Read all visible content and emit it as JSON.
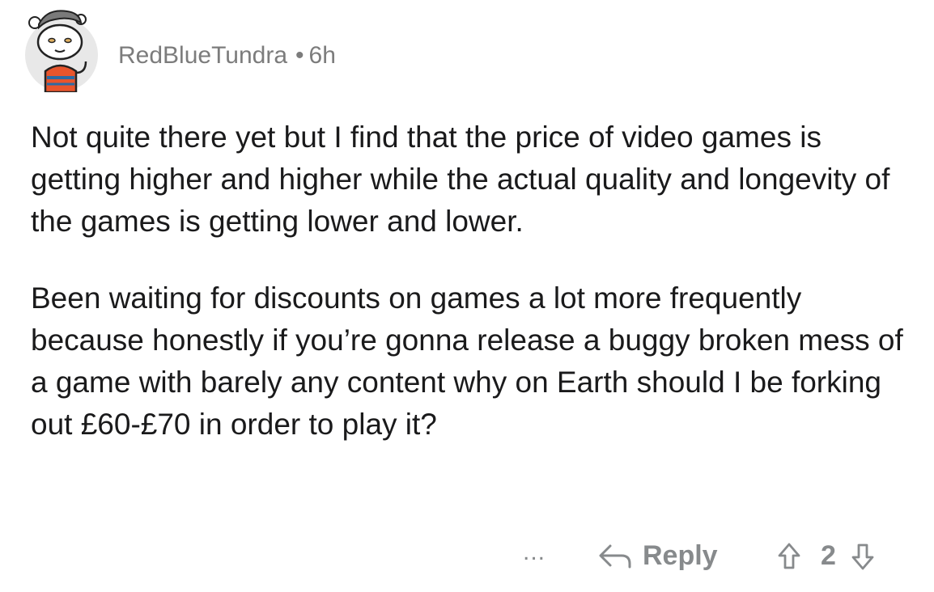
{
  "comment": {
    "username": "RedBlueTundra",
    "separator": "•",
    "age": "6h",
    "paragraphs": [
      "Not quite there yet but I find that the price of video games is getting higher and higher while the actual quality and longevity of the games is getting lower and lower.",
      "Been waiting for discounts on games a lot more frequently because honestly if you’re gonna release a buggy broken mess of a game with barely any content why on Earth should I be forking out £60-£70 in order to play it?"
    ]
  },
  "actions": {
    "more_label": "...",
    "reply_label": "Reply",
    "score": "2"
  },
  "icons": {
    "avatar": "snoo-avatar-icon",
    "reply": "reply-arrow-icon",
    "upvote": "upvote-arrow-icon",
    "downvote": "downvote-arrow-icon"
  },
  "colors": {
    "meta_text": "#7c7c7c",
    "body_text": "#1a1a1b",
    "action_gray": "#878a8c"
  }
}
